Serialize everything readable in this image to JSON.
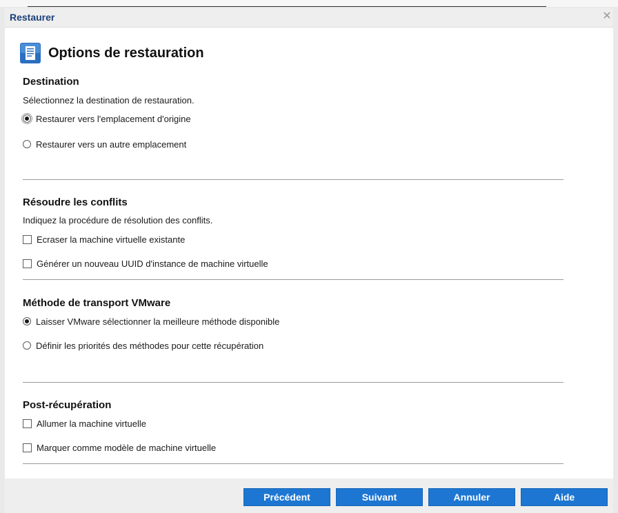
{
  "dialog": {
    "title": "Restaurer",
    "heading": "Options de restauration"
  },
  "destination": {
    "title": "Destination",
    "description": "Sélectionnez la destination de restauration.",
    "options": [
      {
        "label": "Restaurer vers l'emplacement d'origine",
        "checked": true
      },
      {
        "label": "Restaurer vers un autre emplacement",
        "checked": false
      }
    ]
  },
  "conflicts": {
    "title": "Résoudre les conflits",
    "description": "Indiquez la procédure de résolution des conflits.",
    "options": [
      {
        "label": "Ecraser la machine virtuelle existante",
        "checked": false
      },
      {
        "label": "Générer un nouveau UUID d'instance de machine virtuelle",
        "checked": false
      }
    ]
  },
  "transport": {
    "title": "Méthode de transport VMware",
    "options": [
      {
        "label": "Laisser VMware sélectionner la meilleure méthode disponible",
        "checked": true
      },
      {
        "label": "Définir les priorités des méthodes pour cette récupération",
        "checked": false
      }
    ]
  },
  "post": {
    "title": "Post-récupération",
    "options": [
      {
        "label": "Allumer la machine virtuelle",
        "checked": false
      },
      {
        "label": "Marquer comme modèle de machine virtuelle",
        "checked": false
      }
    ]
  },
  "footer": {
    "previous": "Précédent",
    "next": "Suivant",
    "cancel": "Annuler",
    "help": "Aide"
  },
  "colors": {
    "button": "#1d76d2",
    "title_text": "#1b3f78"
  },
  "icons": {
    "header": "document-icon",
    "close": "close-icon"
  }
}
